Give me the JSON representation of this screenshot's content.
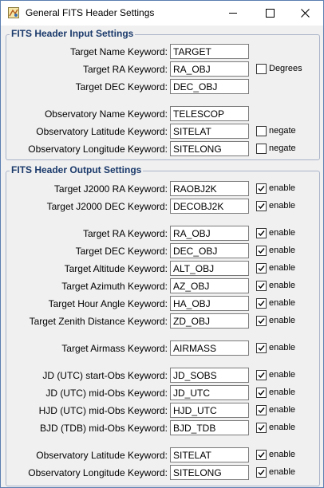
{
  "window": {
    "title": "General FITS Header Settings",
    "icon": "fits-app-icon",
    "minimize_icon": "minimize-icon",
    "maximize_icon": "maximize-icon",
    "close_icon": "close-icon"
  },
  "input_group": {
    "title": "FITS Header Input Settings",
    "rows": [
      {
        "label": "Target Name Keyword:",
        "value": "TARGET"
      },
      {
        "label": "Target RA Keyword:",
        "value": "RA_OBJ",
        "check_label": "Degrees",
        "checked": false
      },
      {
        "label": "Target DEC Keyword:",
        "value": "DEC_OBJ"
      },
      {
        "label": "Observatory Name Keyword:",
        "value": "TELESCOP"
      },
      {
        "label": "Observatory Latitude Keyword:",
        "value": "SITELAT",
        "check_label": "negate",
        "checked": false
      },
      {
        "label": "Observatory Longitude Keyword:",
        "value": "SITELONG",
        "check_label": "negate",
        "checked": false
      }
    ]
  },
  "output_group": {
    "title": "FITS Header Output Settings",
    "rows": [
      {
        "label": "Target J2000 RA Keyword:",
        "value": "RAOBJ2K",
        "check_label": "enable",
        "checked": true
      },
      {
        "label": "Target J2000 DEC Keyword:",
        "value": "DECOBJ2K",
        "check_label": "enable",
        "checked": true
      },
      {
        "label": "Target RA Keyword:",
        "value": "RA_OBJ",
        "check_label": "enable",
        "checked": true
      },
      {
        "label": "Target DEC Keyword:",
        "value": "DEC_OBJ",
        "check_label": "enable",
        "checked": true
      },
      {
        "label": "Target Altitude Keyword:",
        "value": "ALT_OBJ",
        "check_label": "enable",
        "checked": true
      },
      {
        "label": "Target Azimuth Keyword:",
        "value": "AZ_OBJ",
        "check_label": "enable",
        "checked": true
      },
      {
        "label": "Target Hour Angle Keyword:",
        "value": "HA_OBJ",
        "check_label": "enable",
        "checked": true
      },
      {
        "label": "Target Zenith Distance Keyword:",
        "value": "ZD_OBJ",
        "check_label": "enable",
        "checked": true
      },
      {
        "label": "Target Airmass Keyword:",
        "value": "AIRMASS",
        "check_label": "enable",
        "checked": true
      },
      {
        "label": "JD (UTC) start-Obs Keyword:",
        "value": "JD_SOBS",
        "check_label": "enable",
        "checked": true
      },
      {
        "label": "JD (UTC) mid-Obs Keyword:",
        "value": "JD_UTC",
        "check_label": "enable",
        "checked": true
      },
      {
        "label": "HJD (UTC) mid-Obs Keyword:",
        "value": "HJD_UTC",
        "check_label": "enable",
        "checked": true
      },
      {
        "label": "BJD (TDB) mid-Obs Keyword:",
        "value": "BJD_TDB",
        "check_label": "enable",
        "checked": true
      },
      {
        "label": "Observatory Latitude Keyword:",
        "value": "SITELAT",
        "check_label": "enable",
        "checked": true
      },
      {
        "label": "Observatory Longitude Keyword:",
        "value": "SITELONG",
        "check_label": "enable",
        "checked": true
      }
    ]
  }
}
